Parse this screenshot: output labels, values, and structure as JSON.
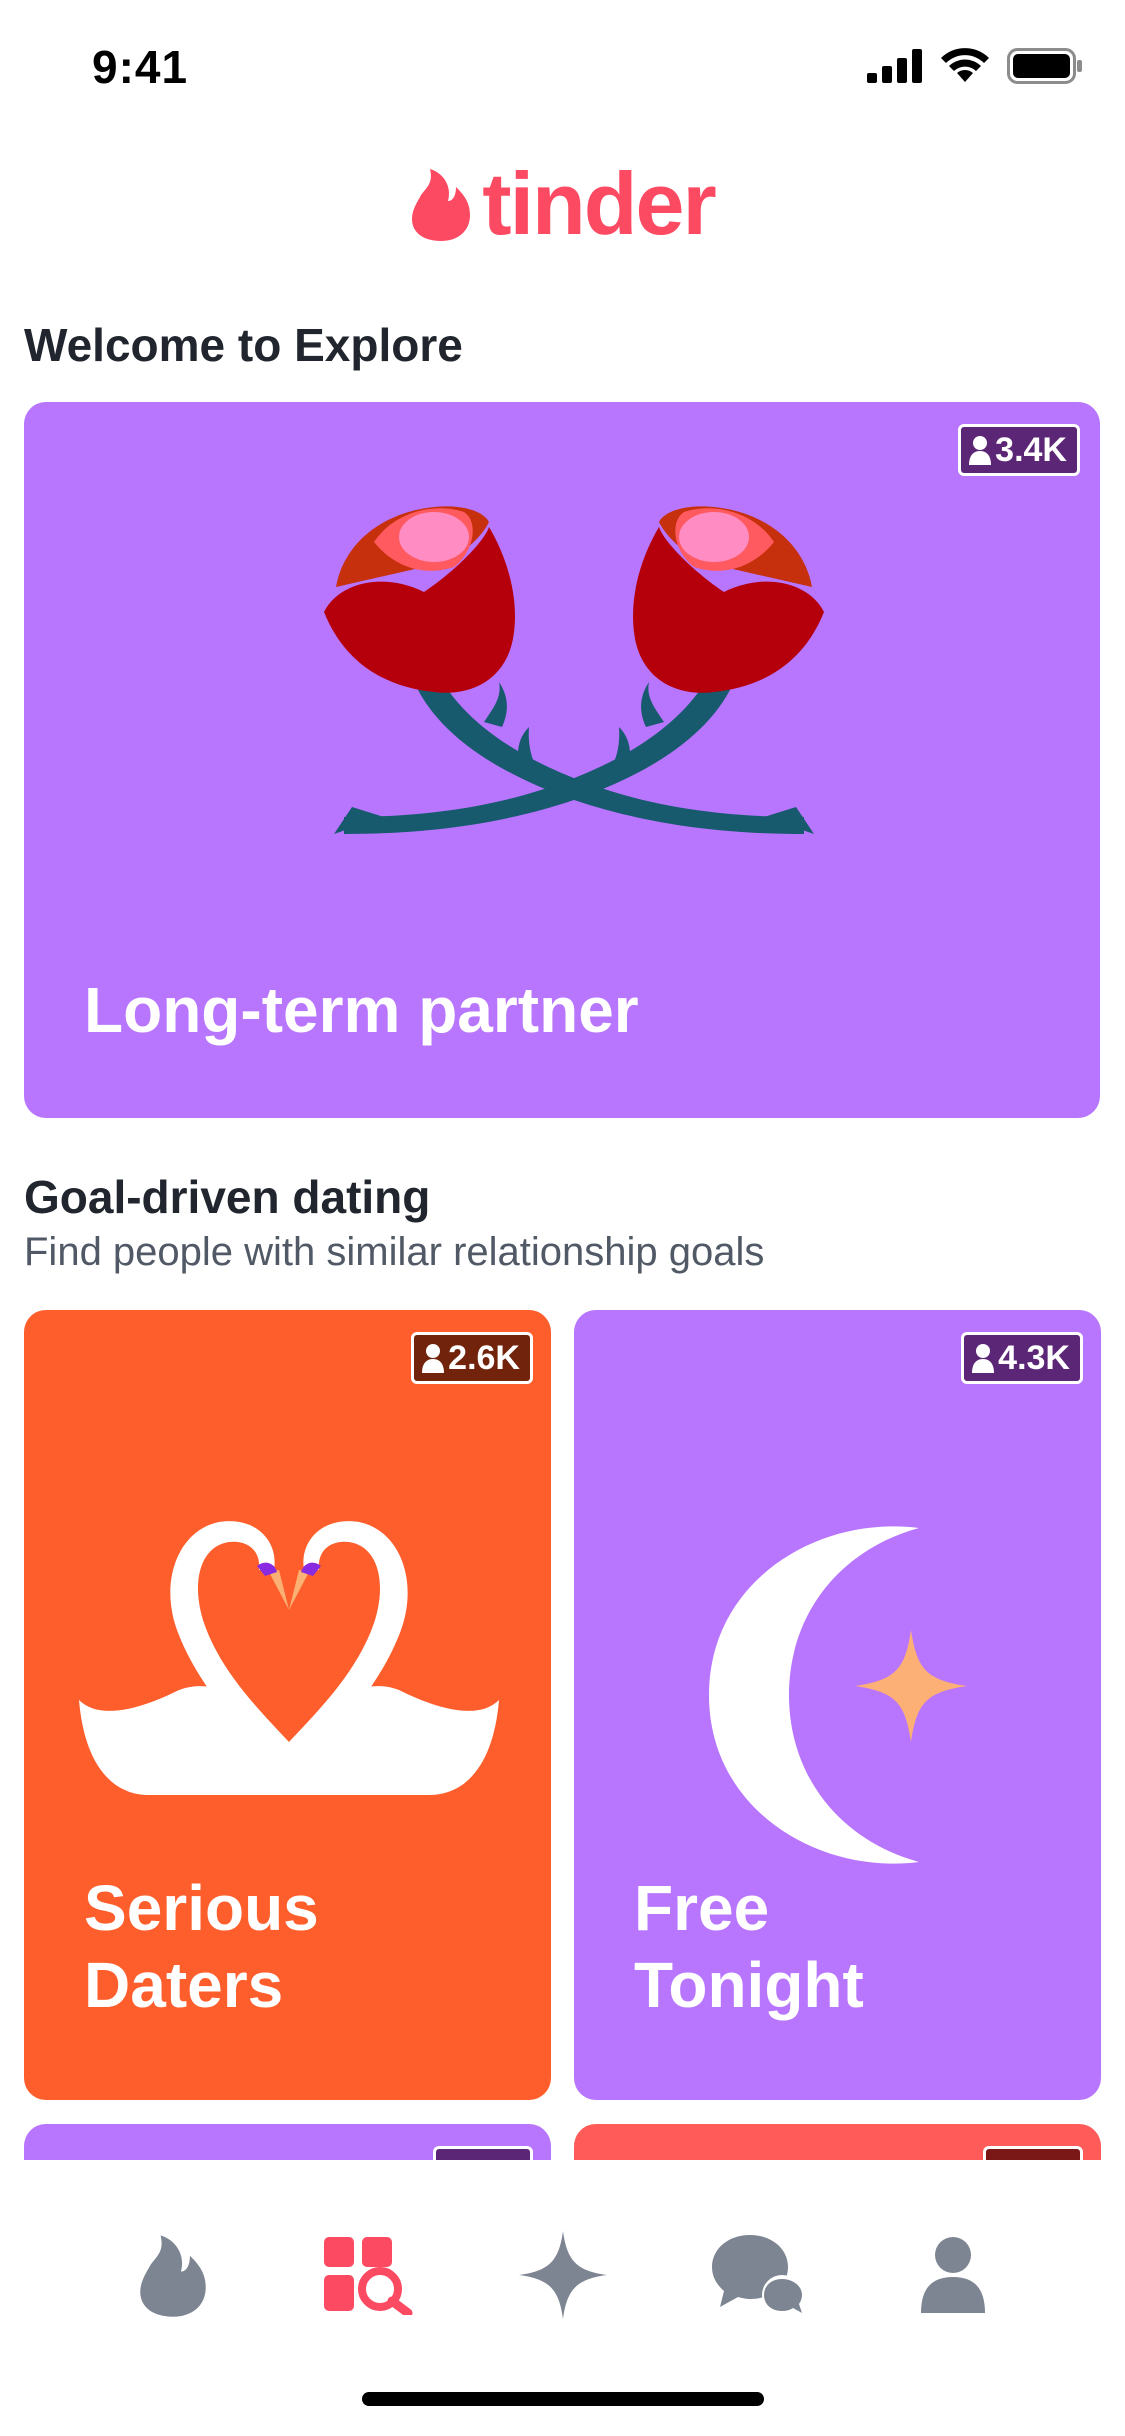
{
  "status_bar": {
    "time": "9:41"
  },
  "app": {
    "logo_text": "tinder",
    "brand_color": "#fd4a63"
  },
  "explore": {
    "welcome_title": "Welcome to Explore",
    "featured_card": {
      "title": "Long-term partner",
      "member_count": "3.4K",
      "color": "#b875fe"
    }
  },
  "goal_section": {
    "title": "Goal-driven dating",
    "subtitle": "Find people with similar relationship goals",
    "cards": [
      {
        "title_line1": "Serious",
        "title_line2": "Daters",
        "member_count": "2.6K",
        "color": "#fd5e2b",
        "icon": "swans-icon"
      },
      {
        "title_line1": "Free",
        "title_line2": "Tonight",
        "member_count": "4.3K",
        "color": "#b875fe",
        "icon": "moon-star-icon"
      }
    ],
    "partial_cards": [
      {
        "color": "#b875fe"
      },
      {
        "color": "#fe5b59"
      }
    ]
  },
  "bottom_nav": {
    "items": [
      {
        "name": "home",
        "icon": "flame-icon",
        "active": false
      },
      {
        "name": "explore",
        "icon": "explore-icon",
        "active": true
      },
      {
        "name": "top-picks",
        "icon": "sparkle-icon",
        "active": false
      },
      {
        "name": "messages",
        "icon": "chat-icon",
        "active": false
      },
      {
        "name": "profile",
        "icon": "profile-icon",
        "active": false
      }
    ],
    "active_color": "#fd4a63",
    "inactive_color": "#7c8591"
  }
}
